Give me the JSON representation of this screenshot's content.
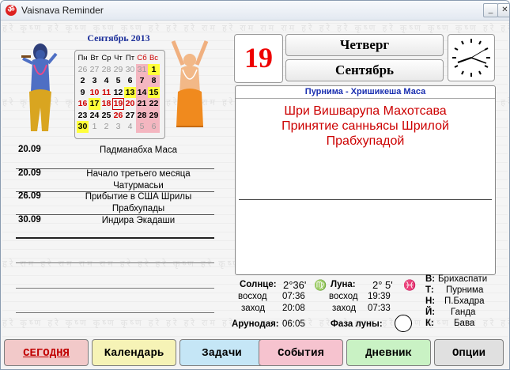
{
  "window": {
    "title": "Vaisnava Reminder",
    "icon": "app-logo-icon"
  },
  "calendar": {
    "title": "Сентябрь 2013",
    "headers": [
      "Пн",
      "Вт",
      "Ср",
      "Чт",
      "Пт",
      "Сб",
      "Вс"
    ],
    "rows": [
      [
        "26",
        "27",
        "28",
        "29",
        "30",
        "31",
        "1"
      ],
      [
        "2",
        "3",
        "4",
        "5",
        "6",
        "7",
        "8"
      ],
      [
        "9",
        "10",
        "11",
        "12",
        "13",
        "14",
        "15"
      ],
      [
        "16",
        "17",
        "18",
        "19",
        "20",
        "21",
        "22"
      ],
      [
        "23",
        "24",
        "25",
        "26",
        "27",
        "28",
        "29"
      ],
      [
        "30",
        "1",
        "2",
        "3",
        "4",
        "5",
        "6"
      ]
    ]
  },
  "events": [
    {
      "date": "20.09",
      "title": "Падманабха Маса"
    },
    {
      "date": "20.09",
      "title": "Начало третьего месяца Чатурмасьи"
    },
    {
      "date": "26.09",
      "title": "Прибытие в США Шрилы Прабхупады"
    },
    {
      "date": "30.09",
      "title": "Индира Экадаши"
    }
  ],
  "today": {
    "day": "19",
    "weekday": "Четверг",
    "month": "Сентябрь"
  },
  "panel": {
    "header": "Пурнима - Хришикеша Маса",
    "lines": [
      "Шри Вишварупа Махотсава",
      "Принятие санньясы Шрилой",
      "Прабхупадой"
    ]
  },
  "astro": {
    "sun_label": "Солнце:",
    "sun_value": "2°36'",
    "sun_sign": "♍",
    "moon_label": "Луна:",
    "moon_value": "2° 5'",
    "moon_sign": "♓",
    "rise_label": "восход",
    "set_label": "заход",
    "sunrise": "07:36",
    "sunset": "20:08",
    "moonrise": "19:39",
    "moonset": "07:33",
    "arunodaya_label": "Арунодая:",
    "arunodaya": "06:05",
    "phase_label": "Фаза луны:",
    "right": [
      {
        "k": "В:",
        "v": "Брихаспати"
      },
      {
        "k": "Т:",
        "v": "Пурнима"
      },
      {
        "k": "Н:",
        "v": "П.Бхадра"
      },
      {
        "k": "Й:",
        "v": "Ганда"
      },
      {
        "k": "К:",
        "v": "Бава"
      }
    ]
  },
  "buttons": [
    {
      "label": "СЕГОДНЯ",
      "color": "#f2c9c9",
      "text": "#c00000"
    },
    {
      "label": "Календарь",
      "color": "#f6f3b6",
      "text": "#000000"
    },
    {
      "label": "Задачи",
      "color": "#c5e6f6",
      "text": "#000000"
    },
    {
      "label": "События",
      "color": "#f6c3cf",
      "text": "#000000"
    },
    {
      "label": "Дневник",
      "color": "#c9f2c4",
      "text": "#000000"
    },
    {
      "label": "Опции",
      "color": "#e0e0e0",
      "text": "#000000"
    }
  ],
  "colors": {
    "accent_red": "#dd0000",
    "header_blue": "#1c2f9a",
    "highlight_yellow": "#ffff3a",
    "highlight_pink": "#f4b6c0"
  }
}
